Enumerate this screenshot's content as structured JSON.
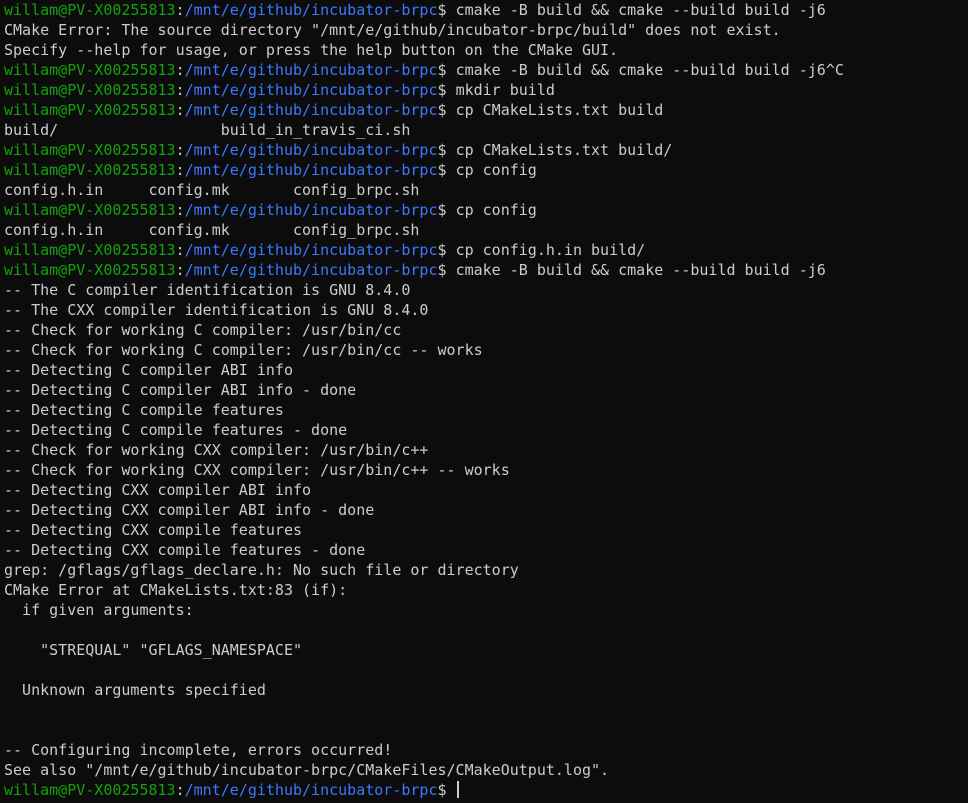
{
  "colors": {
    "background": "#0c0c0c",
    "foreground": "#cccccc",
    "prompt_user": "#13a10e",
    "prompt_path": "#3b78ff"
  },
  "prompt": {
    "user_host": "willam@PV-X00255813",
    "separator": ":",
    "path": "/mnt/e/github/incubator-brpc",
    "symbol": "$ "
  },
  "lines": [
    {
      "type": "prompt",
      "cmd": "cmake -B build && cmake --build build -j6"
    },
    {
      "type": "output",
      "text": "CMake Error: The source directory \"/mnt/e/github/incubator-brpc/build\" does not exist."
    },
    {
      "type": "output",
      "text": "Specify --help for usage, or press the help button on the CMake GUI."
    },
    {
      "type": "prompt",
      "cmd": "cmake -B build && cmake --build build -j6^C"
    },
    {
      "type": "prompt",
      "cmd": "mkdir build"
    },
    {
      "type": "prompt",
      "cmd": "cp CMakeLists.txt build"
    },
    {
      "type": "output",
      "text": "build/                  build_in_travis_ci.sh"
    },
    {
      "type": "prompt",
      "cmd": "cp CMakeLists.txt build/"
    },
    {
      "type": "prompt",
      "cmd": "cp config"
    },
    {
      "type": "output",
      "text": "config.h.in     config.mk       config_brpc.sh"
    },
    {
      "type": "prompt",
      "cmd": "cp config"
    },
    {
      "type": "output",
      "text": "config.h.in     config.mk       config_brpc.sh"
    },
    {
      "type": "prompt",
      "cmd": "cp config.h.in build/"
    },
    {
      "type": "prompt",
      "cmd": "cmake -B build && cmake --build build -j6"
    },
    {
      "type": "output",
      "text": "-- The C compiler identification is GNU 8.4.0"
    },
    {
      "type": "output",
      "text": "-- The CXX compiler identification is GNU 8.4.0"
    },
    {
      "type": "output",
      "text": "-- Check for working C compiler: /usr/bin/cc"
    },
    {
      "type": "output",
      "text": "-- Check for working C compiler: /usr/bin/cc -- works"
    },
    {
      "type": "output",
      "text": "-- Detecting C compiler ABI info"
    },
    {
      "type": "output",
      "text": "-- Detecting C compiler ABI info - done"
    },
    {
      "type": "output",
      "text": "-- Detecting C compile features"
    },
    {
      "type": "output",
      "text": "-- Detecting C compile features - done"
    },
    {
      "type": "output",
      "text": "-- Check for working CXX compiler: /usr/bin/c++"
    },
    {
      "type": "output",
      "text": "-- Check for working CXX compiler: /usr/bin/c++ -- works"
    },
    {
      "type": "output",
      "text": "-- Detecting CXX compiler ABI info"
    },
    {
      "type": "output",
      "text": "-- Detecting CXX compiler ABI info - done"
    },
    {
      "type": "output",
      "text": "-- Detecting CXX compile features"
    },
    {
      "type": "output",
      "text": "-- Detecting CXX compile features - done"
    },
    {
      "type": "output",
      "text": "grep: /gflags/gflags_declare.h: No such file or directory"
    },
    {
      "type": "output",
      "text": "CMake Error at CMakeLists.txt:83 (if):"
    },
    {
      "type": "output",
      "text": "  if given arguments:"
    },
    {
      "type": "output",
      "text": ""
    },
    {
      "type": "output",
      "text": "    \"STREQUAL\" \"GFLAGS_NAMESPACE\""
    },
    {
      "type": "output",
      "text": ""
    },
    {
      "type": "output",
      "text": "  Unknown arguments specified"
    },
    {
      "type": "output",
      "text": ""
    },
    {
      "type": "output",
      "text": ""
    },
    {
      "type": "output",
      "text": "-- Configuring incomplete, errors occurred!"
    },
    {
      "type": "output",
      "text": "See also \"/mnt/e/github/incubator-brpc/CMakeFiles/CMakeOutput.log\"."
    },
    {
      "type": "prompt",
      "cmd": "",
      "cursor": true
    }
  ]
}
